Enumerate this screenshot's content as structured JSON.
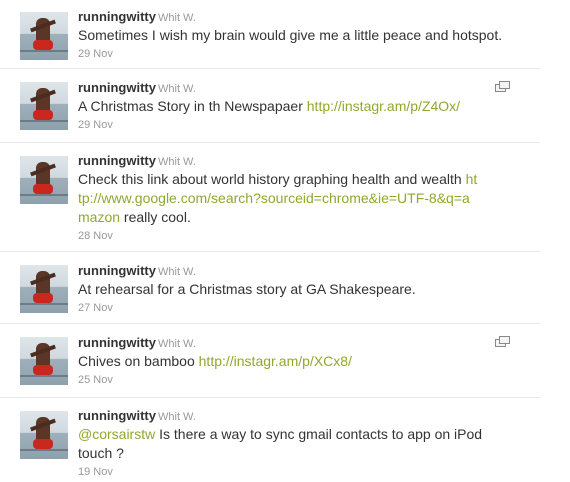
{
  "tweets": [
    {
      "screen_name": "runningwitty",
      "full_name": "Whit W.",
      "text_before": "Sometimes I wish my brain would give me a little peace and hotspot.",
      "link": "",
      "text_after": "",
      "timestamp": "29 Nov",
      "has_media": false
    },
    {
      "screen_name": "runningwitty",
      "full_name": "Whit W.",
      "text_before": "A Christmas Story in th Newspapaer ",
      "link": "http://instagr.am/p/Z4Ox/",
      "text_after": "",
      "timestamp": "29 Nov",
      "has_media": true
    },
    {
      "screen_name": "runningwitty",
      "full_name": "Whit W.",
      "text_before": "Check this link about world history graphing health and wealth ",
      "link": "http://www.google.com/search?sourceid=chrome&ie=UTF-8&q=amazon",
      "text_after": " really cool.",
      "timestamp": "28 Nov",
      "has_media": false
    },
    {
      "screen_name": "runningwitty",
      "full_name": "Whit W.",
      "text_before": "At rehearsal for a Christmas story at GA Shakespeare.",
      "link": "",
      "text_after": "",
      "timestamp": "27 Nov",
      "has_media": false
    },
    {
      "screen_name": "runningwitty",
      "full_name": "Whit W.",
      "text_before": "Chives on bamboo ",
      "link": "http://instagr.am/p/XCx8/",
      "text_after": "",
      "timestamp": "25 Nov",
      "has_media": true
    },
    {
      "screen_name": "runningwitty",
      "full_name": "Whit W.",
      "text_before": "",
      "link": "@corsairstw",
      "text_after": " Is there a way to sync gmail contacts to app on iPod touch ?",
      "timestamp": "19 Nov",
      "has_media": false
    }
  ]
}
